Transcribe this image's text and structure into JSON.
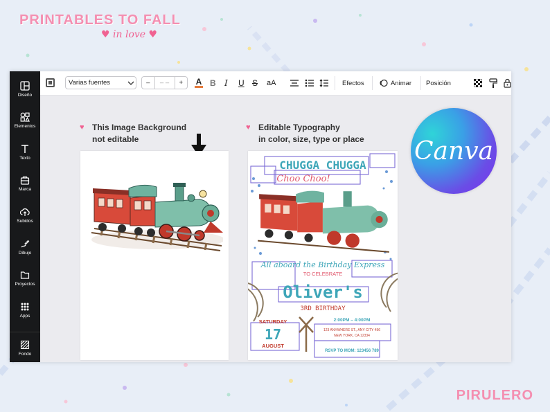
{
  "branding": {
    "title": "PRINTABLES TO FALL",
    "subtitle": "in love",
    "footer": "PIRULERO"
  },
  "sidebar": {
    "items": [
      {
        "label": "Diseño",
        "icon": "layout-icon"
      },
      {
        "label": "Elementos",
        "icon": "shapes-icon"
      },
      {
        "label": "Texto",
        "icon": "text-icon"
      },
      {
        "label": "Marca",
        "icon": "brand-icon"
      },
      {
        "label": "Subidos",
        "icon": "upload-icon"
      },
      {
        "label": "Dibujo",
        "icon": "draw-icon"
      },
      {
        "label": "Proyectos",
        "icon": "folder-icon"
      },
      {
        "label": "Apps",
        "icon": "apps-icon"
      },
      {
        "label": "Fondo",
        "icon": "background-icon"
      }
    ]
  },
  "toolbar": {
    "font": "Varias fuentes",
    "size_minus": "–",
    "size_value": "– –",
    "size_plus": "+",
    "effects": "Efectos",
    "animate": "Animar",
    "position": "Posición",
    "case_label": "aA"
  },
  "notes": {
    "left": [
      "This Image Background",
      "not editable"
    ],
    "right": [
      "Editable Typography",
      "in color, size, type or place"
    ]
  },
  "logo": {
    "text": "Canva"
  },
  "invitation": {
    "headline": "CHUGGA CHUGGA",
    "sound": "Choo Choo!",
    "aboard": "All aboard the Birthday Express",
    "celebrate": "TO CELEBRATE",
    "name": "Oliver's",
    "birthday": "3RD BIRTHDAY",
    "day": "SATURDAY",
    "date": "17",
    "month": "AUGUST",
    "time": "2:00PM – 4:00PM",
    "address1": "123 ANYWHERE ST., ANY CITY 456",
    "address2": "NEW YORK, CA 12334",
    "rsvp": "RSVP TO MOM: 123456 789"
  },
  "colors": {
    "sidebar": "#18191b",
    "accent_pink": "#f48fb1",
    "invite_teal": "#3ea6b8",
    "invite_red": "#c0392b",
    "invite_purple": "#6a5acd"
  }
}
